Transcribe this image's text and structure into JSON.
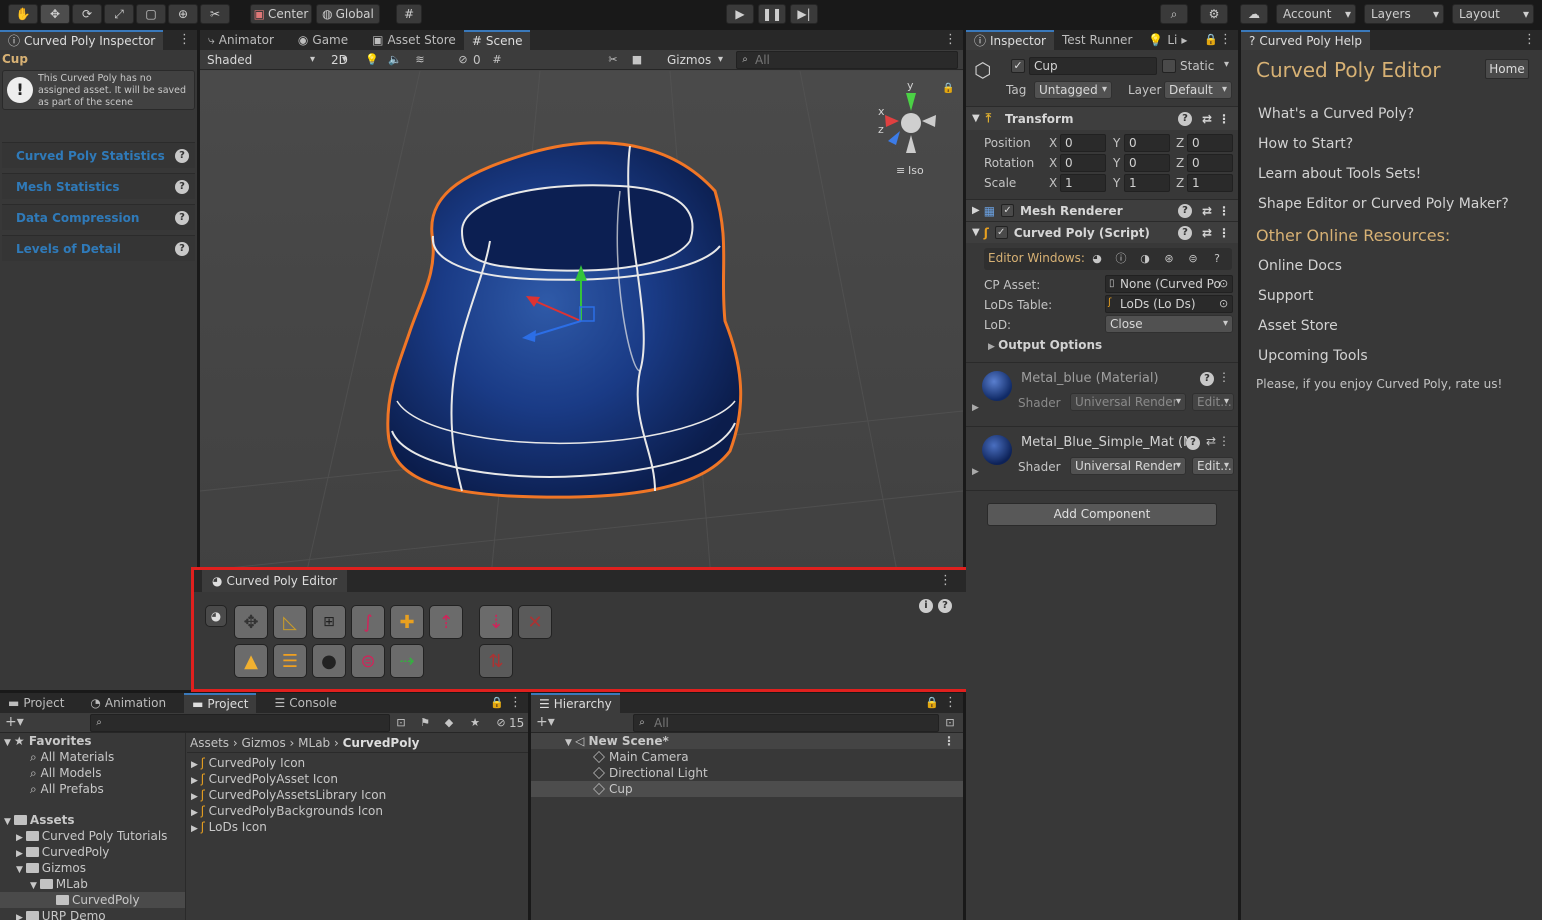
{
  "toolbar": {
    "pivot": "Center",
    "space": "Global",
    "account": "Account",
    "layers": "Layers",
    "layout": "Layout"
  },
  "cp_inspector": {
    "tab": "Curved Poly Inspector",
    "object": "Cup",
    "warning": "This Curved Poly has no assigned asset. It will be saved as part of the scene",
    "sections": [
      "Curved Poly Statistics",
      "Mesh Statistics",
      "Data Compression",
      "Levels of Detail"
    ]
  },
  "scene": {
    "tabs": [
      "Animator",
      "Game",
      "Asset Store",
      "Scene"
    ],
    "shading": "Shaded",
    "mode2d": "2D",
    "hidden_count": "0",
    "gizmos": "Gizmos",
    "search_placeholder": "All",
    "iso": "Iso",
    "axis_x": "x",
    "axis_y": "y",
    "axis_z": "z"
  },
  "cp_editor": {
    "title": "Curved Poly Editor"
  },
  "inspector": {
    "tabs": [
      "Inspector",
      "Test Runner",
      "Li"
    ],
    "name": "Cup",
    "static": "Static",
    "tag_label": "Tag",
    "tag": "Untagged",
    "layer_label": "Layer",
    "layer": "Default",
    "transform": {
      "title": "Transform",
      "rows": [
        {
          "label": "Position",
          "x": "0",
          "y": "0",
          "z": "0"
        },
        {
          "label": "Rotation",
          "x": "0",
          "y": "0",
          "z": "0"
        },
        {
          "label": "Scale",
          "x": "1",
          "y": "1",
          "z": "1"
        }
      ]
    },
    "mesh_renderer": "Mesh Renderer",
    "curved_poly": "Curved Poly (Script)",
    "editor_windows": "Editor Windows:",
    "cp_asset_label": "CP Asset:",
    "cp_asset": "None (Curved Po",
    "lods_label": "LoDs Table:",
    "lods": "LoDs (Lo Ds)",
    "lod_label": "LoD:",
    "lod": "Close",
    "output_options": "Output Options",
    "materials": [
      {
        "name": "Metal_blue (Material)",
        "shader_label": "Shader",
        "shader": "Universal Render",
        "edit": "Edit..."
      },
      {
        "name": "Metal_Blue_Simple_Mat (M",
        "shader_label": "Shader",
        "shader": "Universal Render",
        "edit": "Edit..."
      }
    ],
    "add_component": "Add Component"
  },
  "help": {
    "tab": "Curved Poly Help",
    "title": "Curved Poly Editor",
    "home": "Home",
    "links": [
      "What's a Curved Poly?",
      "How to Start?",
      "Learn about Tools Sets!",
      "Shape Editor or Curved Poly Maker?"
    ],
    "resources_title": "Other Online Resources:",
    "resources": [
      "Online Docs",
      "Support",
      "Asset Store",
      "Upcoming Tools"
    ],
    "rate": "Please, if you enjoy Curved Poly, rate us!"
  },
  "project": {
    "tabs": [
      "Project",
      "Animation",
      "Project",
      "Console"
    ],
    "hidden_count": "15",
    "favorites_label": "Favorites",
    "favorites": [
      "All Materials",
      "All Models",
      "All Prefabs"
    ],
    "assets_label": "Assets",
    "tree": [
      {
        "name": "Curved Poly Tutorials",
        "indent": 1
      },
      {
        "name": "CurvedPoly",
        "indent": 1
      },
      {
        "name": "Gizmos",
        "indent": 1
      },
      {
        "name": "MLab",
        "indent": 2
      },
      {
        "name": "CurvedPoly",
        "indent": 3
      },
      {
        "name": "URP Demo",
        "indent": 1
      }
    ],
    "breadcrumb": [
      "Assets",
      "Gizmos",
      "MLab",
      "CurvedPoly"
    ],
    "files": [
      "CurvedPoly Icon",
      "CurvedPolyAsset Icon",
      "CurvedPolyAssetsLibrary Icon",
      "CurvedPolyBackgrounds Icon",
      "LoDs Icon"
    ]
  },
  "hierarchy": {
    "tab": "Hierarchy",
    "search_placeholder": "All",
    "scene": "New Scene*",
    "items": [
      "Main Camera",
      "Directional Light",
      "Cup"
    ]
  },
  "colors": {
    "accent": "#3a79bb",
    "highlight": "#e0201e",
    "help_title": "#d7b174"
  }
}
